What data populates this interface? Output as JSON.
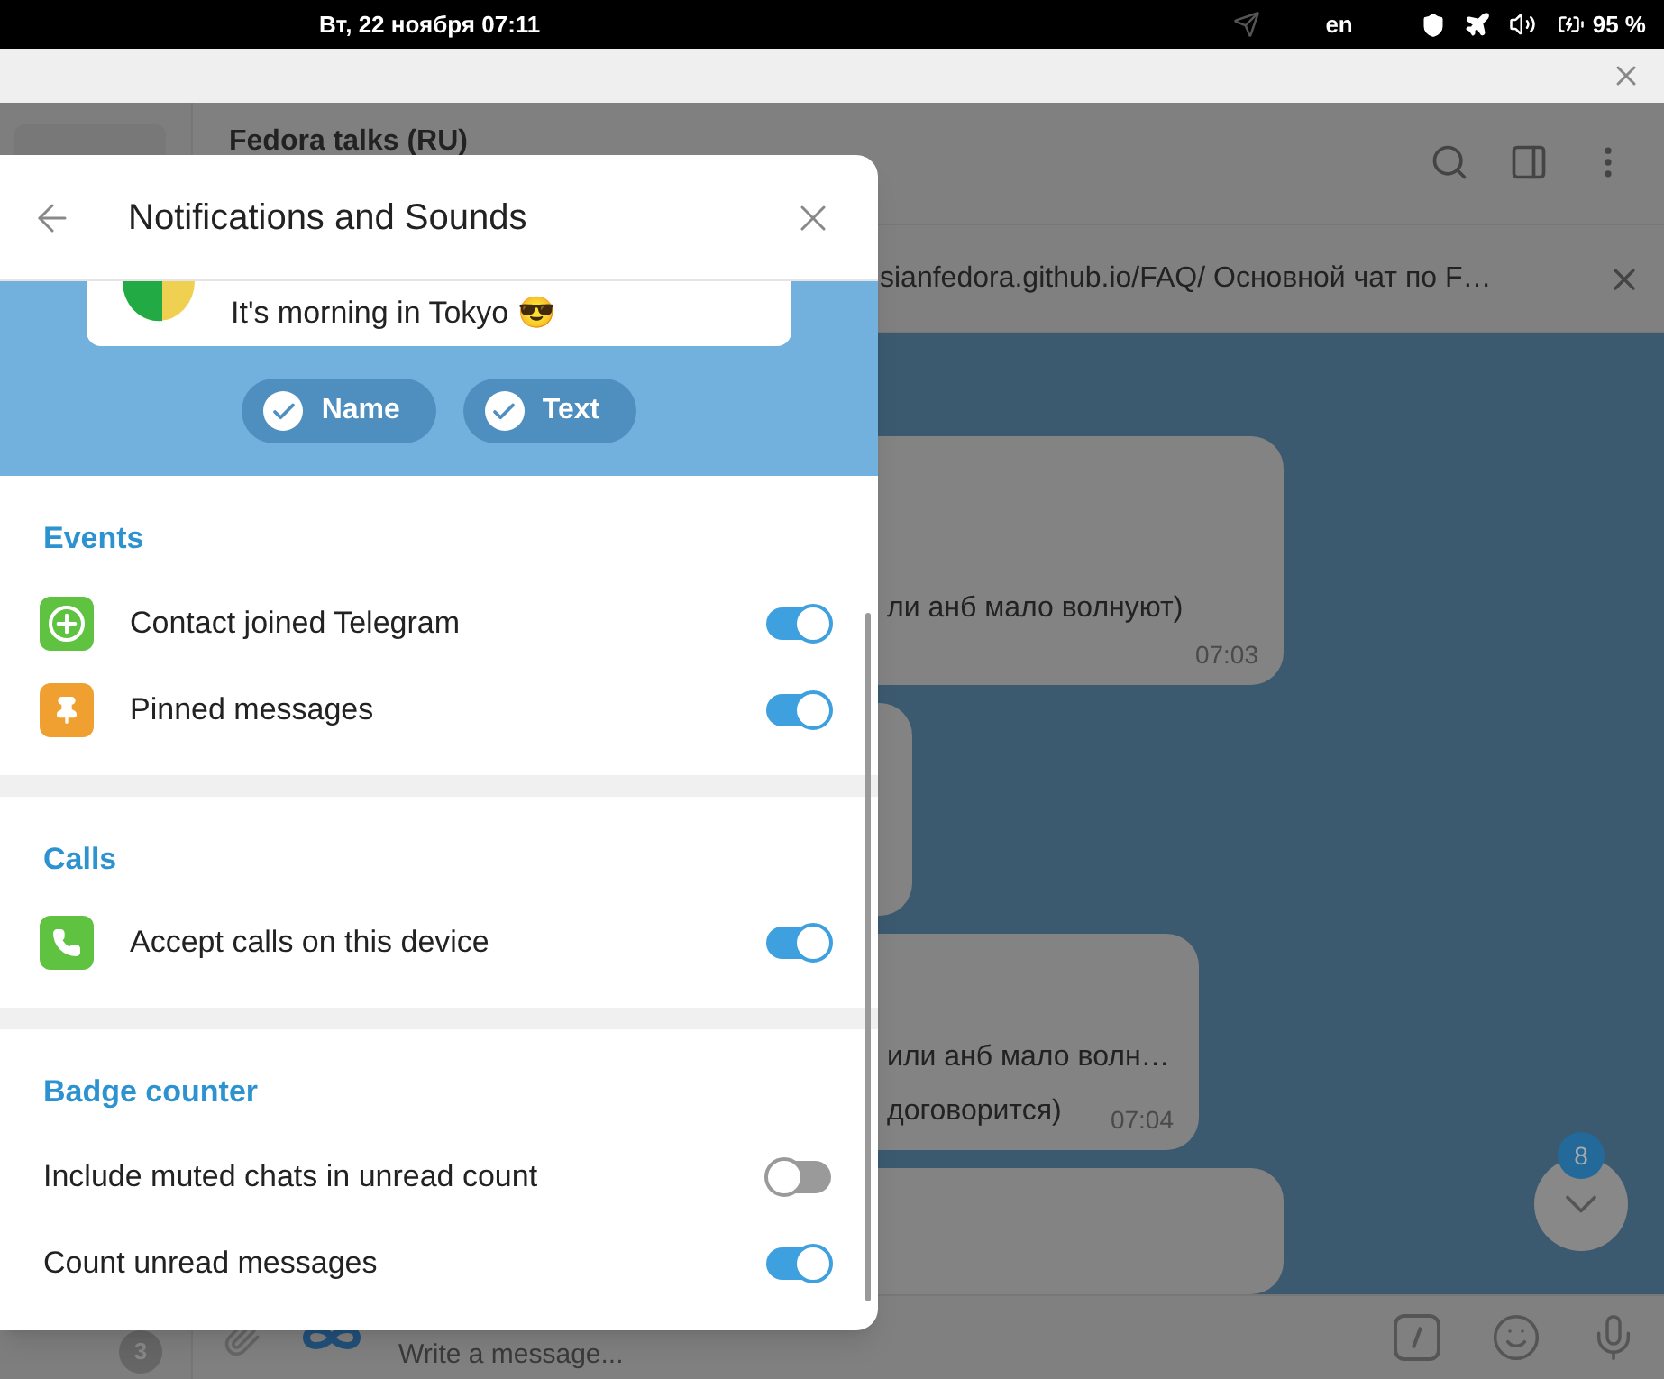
{
  "status_bar": {
    "date_time": "Вт, 22 ноября  07:11",
    "keyboard_layout": "en",
    "battery": "95 %"
  },
  "sidebar": {
    "unread_badge": "3"
  },
  "chat": {
    "title": "Fedora talks (RU)",
    "pinned_message": "sianfedora.github.io/FAQ/ Основной чат по F…",
    "messages": [
      {
        "kind": "text",
        "lines": [
          "ли анб мало волнуют)"
        ],
        "time": "07:03"
      },
      {
        "kind": "covered"
      },
      {
        "kind": "text",
        "lines": [
          "или анб мало волн…",
          "договорится)"
        ],
        "time": "07:04"
      },
      {
        "kind": "covered"
      }
    ],
    "unread_count": "8",
    "composer": {
      "placeholder": "Write a message..."
    }
  },
  "dialog": {
    "title": "Notifications and Sounds",
    "preview": {
      "message": "It's morning in Tokyo 😎",
      "options": [
        {
          "label": "Name",
          "selected": true
        },
        {
          "label": "Text",
          "selected": true
        }
      ]
    },
    "sections": [
      {
        "title": "Events",
        "rows": [
          {
            "label": "Contact joined Telegram",
            "kind": "contact",
            "color": "#5fc240",
            "on": true
          },
          {
            "label": "Pinned messages",
            "kind": "pin",
            "color": "#f0a030",
            "on": true
          }
        ]
      },
      {
        "title": "Calls",
        "rows": [
          {
            "label": "Accept calls on this device",
            "kind": "call",
            "color": "#5fc240",
            "on": true
          }
        ]
      },
      {
        "title": "Badge counter",
        "rows": [
          {
            "label": "Include muted chats in unread count",
            "on": false
          },
          {
            "label": "Count unread messages",
            "on": true
          }
        ]
      }
    ]
  }
}
